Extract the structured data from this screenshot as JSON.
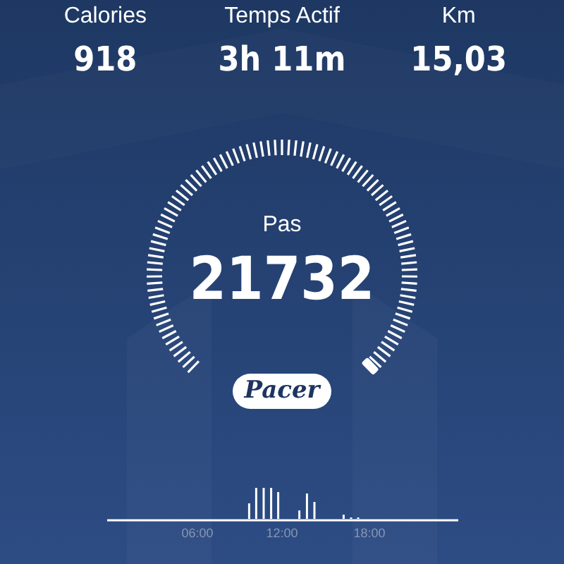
{
  "stats": [
    {
      "label": "Calories",
      "value": "918"
    },
    {
      "label": "Temps Actif",
      "value": "3h 11m"
    },
    {
      "label": "Km",
      "value": "15,03"
    }
  ],
  "gauge": {
    "label": "Pas",
    "value": "21732"
  },
  "logo": "Pacer",
  "timeline": {
    "ticks": [
      "06:00",
      "12:00",
      "18:00"
    ]
  }
}
